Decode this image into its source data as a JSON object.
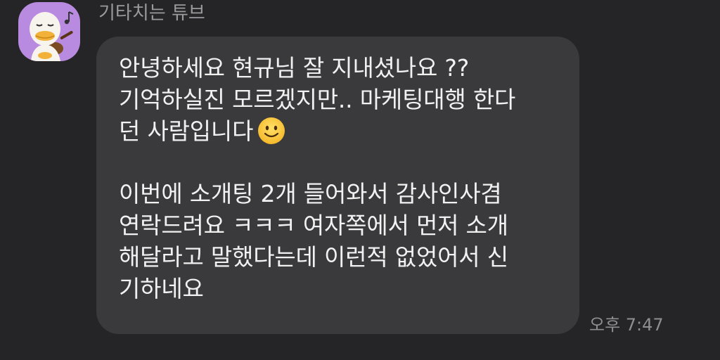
{
  "chat": {
    "sender_name": "기타치는 튜브",
    "avatar_icon": "duck-character-playing-guitar",
    "message_lines": [
      "안녕하세요 현규님 잘 지내셨나요 ??",
      "기억하실진 모르겠지만.. 마케팅대행 한다",
      "던 사람입니다",
      "",
      "이번에 소개팅 2개 들어와서 감사인사겸",
      "연락드려요 ㅋㅋㅋ 여자쪽에서 먼저 소개",
      "해달라고 말했다는데 이런적 없었어서 신",
      "기하네요"
    ],
    "emoji_icon": "slightly-smiling-face",
    "timestamp": "오후 7:47"
  },
  "colors": {
    "background": "#252527",
    "bubble": "#3a3a3c",
    "message_text": "#f1f1f1",
    "meta_text": "#9a9a9e",
    "avatar_bg": "#b88be0"
  }
}
